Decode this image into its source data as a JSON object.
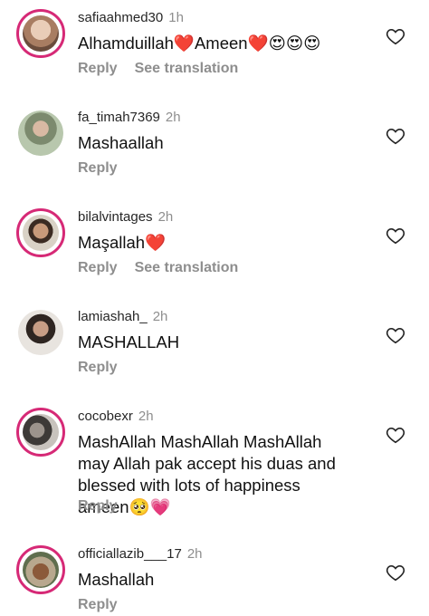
{
  "comments": [
    {
      "username": "safiaahmed30",
      "time": "1h",
      "text": "Alhamduillah❤️Ameen❤️😍😍😍",
      "reply": "Reply",
      "translate": "See translation",
      "avatar_color": "#c9a58c"
    },
    {
      "username": "fa_timah7369",
      "time": "2h",
      "text": "Mashaallah",
      "reply": "Reply",
      "translate": "",
      "avatar_color": "#a9b79a"
    },
    {
      "username": "bilalvintages",
      "time": "2h",
      "text": "Maşallah❤️",
      "reply": "Reply",
      "translate": "See translation",
      "avatar_color": "#8a6a55"
    },
    {
      "username": "lamiashah_",
      "time": "2h",
      "text": "MASHALLAH",
      "reply": "Reply",
      "translate": "",
      "avatar_color": "#b7a19b"
    },
    {
      "username": "cocobexr",
      "time": "2h",
      "text": "MashAllah MashAllah MashAllah may Allah pak accept his duas and blessed with lots of happiness ameen🥺💗",
      "reply": "Reply",
      "translate": "",
      "avatar_color": "#6d6a66"
    },
    {
      "username": "officiallazib___17",
      "time": "2h",
      "text": "Mashallah",
      "reply": "Reply",
      "translate": "",
      "avatar_color": "#7a5a3e"
    }
  ]
}
